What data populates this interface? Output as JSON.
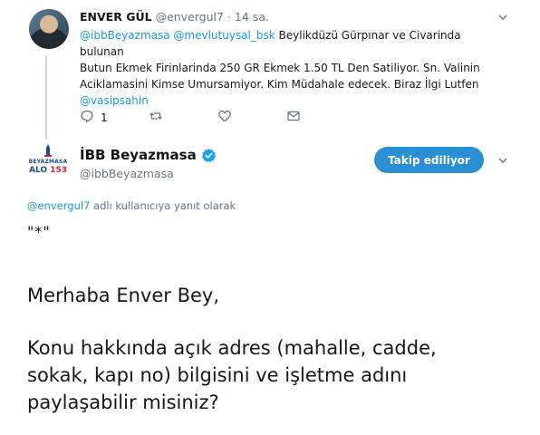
{
  "tweet1": {
    "name": "ENVER GÜL",
    "handle": "@envergul7",
    "separator": "·",
    "time": "14 sa.",
    "mention1": "@ibbBeyazmasa",
    "mention2": "@mevlutuysal_bsk",
    "text_line1": " Beylikdüzü Gürpınar ve Civarinda bulunan",
    "text_line2": "Butun Ekmek Firinlarinda 250 GR Ekmek 1.50 TL Den Satiliyor. Sn. Valinin",
    "text_line3": "Aciklamasini Kimse Umursamiyor. Kim Müdahale edecek.  Biraz İlgi Lutfen",
    "mention3": "@vasipsahin",
    "reply_count": "1",
    "icons": {
      "reply": "reply-icon",
      "retweet": "retweet-icon",
      "like": "heart-icon",
      "dm": "envelope-icon",
      "menu": "chevron-down-icon"
    }
  },
  "tweet2": {
    "name": "İBB Beyazmasa",
    "handle": "@ibbBeyazmasa",
    "follow_label": "Takip ediliyor",
    "logo_text": "BEYAZMASA",
    "logo_alo": "ALO",
    "logo_number": "153",
    "reply_to_handle": "@envergul7",
    "reply_to_text": " adlı kullanıcıya yanıt olarak",
    "quote": "\"*\"",
    "body_line1": "Merhaba Enver Bey,",
    "body_line2": "Konu hakkında açık adres (mahalle, cadde,",
    "body_line3": "sokak, kapı no) bilgisini ve işletme adını",
    "body_line4": "paylaşabilir misiniz?"
  },
  "colors": {
    "link": "#1b95e0",
    "follow_button": "#2b8fd6",
    "muted": "#657786",
    "verified": "#1da1f2",
    "logo_blue": "#1b4f8f",
    "logo_red": "#d9232d"
  }
}
